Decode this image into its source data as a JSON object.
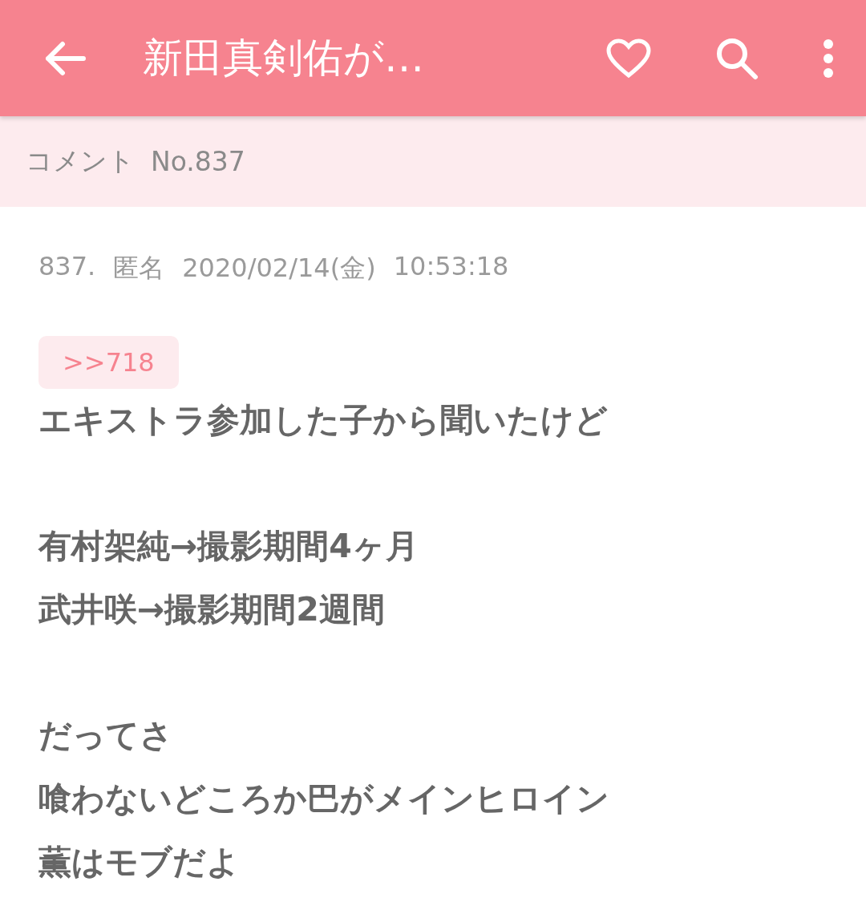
{
  "app_bar": {
    "title": "新田真剣佑が…"
  },
  "subheader": {
    "label": "コメント",
    "number": "No.837"
  },
  "comment": {
    "index": "837.",
    "author": "匿名",
    "date": "2020/02/14(金)",
    "time": "10:53:18",
    "reply_to": ">>718",
    "paragraphs": [
      [
        "エキストラ参加した子から聞いたけど"
      ],
      [
        "有村架純→撮影期間4ヶ月",
        "武井咲→撮影期間2週間"
      ],
      [
        "だってさ",
        "喰わないどころか巴がメインヒロイン",
        "薫はモブだよ"
      ]
    ]
  }
}
